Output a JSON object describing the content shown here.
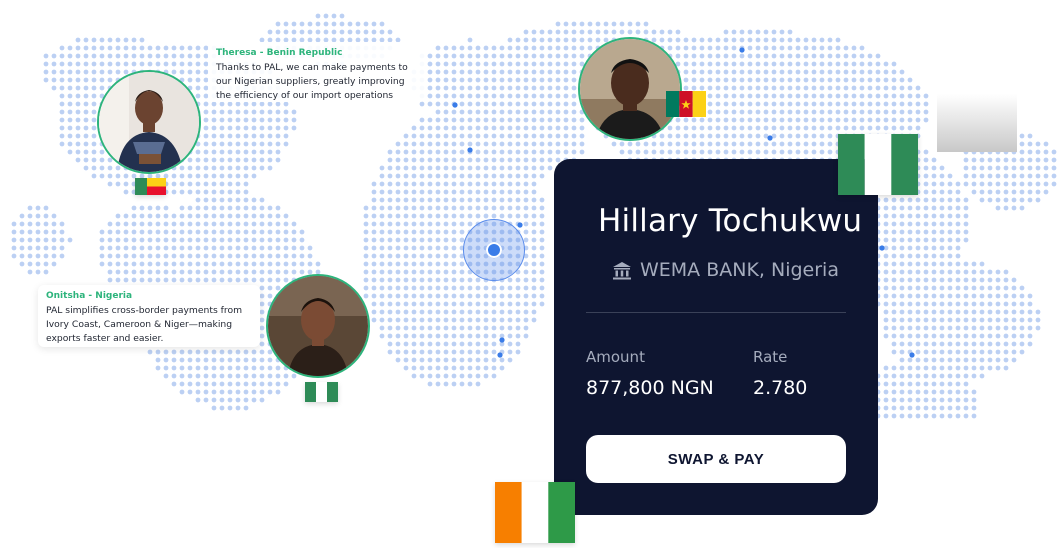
{
  "testimonials": [
    {
      "name": "Theresa  - Benin Republic",
      "text": "Thanks to PAL, we can make payments to our Nigerian suppliers, greatly improving the efficiency of our import operations"
    },
    {
      "name": "Onitsha - Nigeria",
      "text": "PAL simplifies cross-border payments from Ivory Coast, Cameroon & Niger—making exports faster and easier."
    }
  ],
  "card": {
    "recipient_name": "Hillary Tochukwu",
    "bank": "WEMA BANK, Nigeria",
    "amount_label": "Amount",
    "amount_value": "877,800 NGN",
    "rate_label": "Rate",
    "rate_value": "2.780",
    "button_label": "SWAP & PAY",
    "bank_icon": "bank-icon"
  },
  "flags": {
    "benin": "benin-flag",
    "nigeria": "nigeria-flag",
    "cameroon": "cameroon-flag",
    "ivory_coast": "ivory-coast-flag"
  },
  "colors": {
    "accent_green": "#2db47c",
    "card_background": "#0e1530",
    "map_dot": "#bcd0f3",
    "map_dot_highlight": "#3a7ce8"
  }
}
